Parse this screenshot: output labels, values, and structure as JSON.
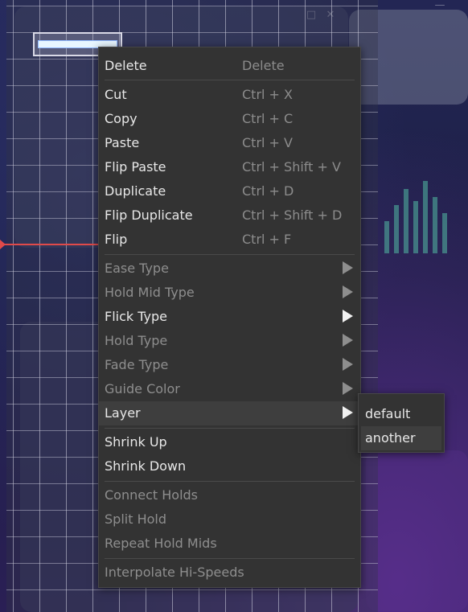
{
  "menu": {
    "items": [
      {
        "label": "Delete",
        "shortcut": "Delete"
      },
      {
        "label": "Cut",
        "shortcut": "Ctrl + X"
      },
      {
        "label": "Copy",
        "shortcut": "Ctrl + C"
      },
      {
        "label": "Paste",
        "shortcut": "Ctrl + V"
      },
      {
        "label": "Flip Paste",
        "shortcut": "Ctrl + Shift + V"
      },
      {
        "label": "Duplicate",
        "shortcut": "Ctrl + D"
      },
      {
        "label": "Flip Duplicate",
        "shortcut": "Ctrl + Shift + D"
      },
      {
        "label": "Flip",
        "shortcut": "Ctrl + F"
      },
      {
        "label": "Ease Type",
        "enabled": false
      },
      {
        "label": "Hold Mid Type",
        "enabled": false
      },
      {
        "label": "Flick Type",
        "enabled": true
      },
      {
        "label": "Hold Type",
        "enabled": false
      },
      {
        "label": "Fade Type",
        "enabled": false
      },
      {
        "label": "Guide Color",
        "enabled": false
      },
      {
        "label": "Layer",
        "enabled": true,
        "highlighted": true
      },
      {
        "label": "Shrink Up",
        "enabled": true
      },
      {
        "label": "Shrink Down",
        "enabled": true
      },
      {
        "label": "Connect Holds",
        "enabled": false
      },
      {
        "label": "Split Hold",
        "enabled": false
      },
      {
        "label": "Repeat Hold Mids",
        "enabled": false
      },
      {
        "label": "Interpolate Hi-Speeds",
        "enabled": false
      }
    ]
  },
  "layer_submenu": {
    "items": [
      {
        "label": "default"
      },
      {
        "label": "another",
        "highlighted": true
      }
    ]
  },
  "colors": {
    "menu_bg": "#333333",
    "menu_text": "#e8e8e8",
    "disabled_text": "#8e8e8e",
    "shortcut_text": "#8c8c8c",
    "highlight_bg": "#3e3e3e",
    "playhead": "#e04a4a"
  }
}
